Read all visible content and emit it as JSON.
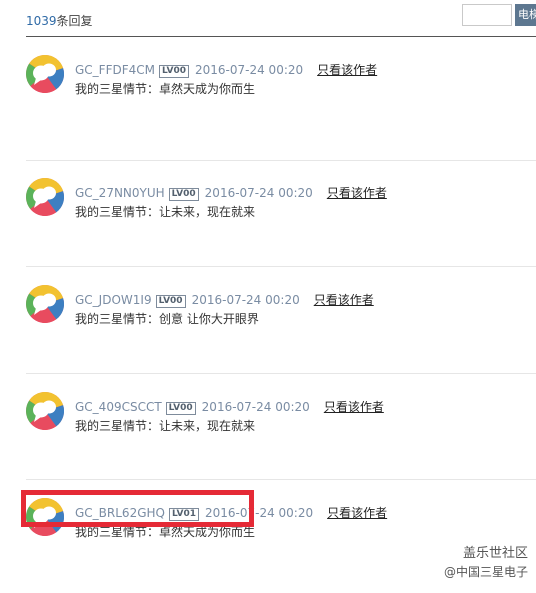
{
  "header": {
    "reply_count": "1039",
    "reply_suffix": "条回复",
    "search_value": "",
    "search_button_label": "电梯直达"
  },
  "posts": [
    {
      "username": "GC_FFDF4CM",
      "level": "LV00",
      "time": "2016-07-24 00:20",
      "author_link": "只看该作者",
      "content": "我的三星情节：卓然天成为你而生"
    },
    {
      "username": "GC_27NN0YUH",
      "level": "LV00",
      "time": "2016-07-24 00:20",
      "author_link": "只看该作者",
      "content": "我的三星情节：让未来，现在就来"
    },
    {
      "username": "GC_JDOW1I9",
      "level": "LV00",
      "time": "2016-07-24 00:20",
      "author_link": "只看该作者",
      "content": "我的三星情节：创意 让你大开眼界"
    },
    {
      "username": "GC_409CSCCT",
      "level": "LV00",
      "time": "2016-07-24 00:20",
      "author_link": "只看该作者",
      "content": "我的三星情节：让未来，现在就来"
    },
    {
      "username": "GC_BRL62GHQ",
      "level": "LV01",
      "time": "2016-07-24 00:20",
      "author_link": "只看该作者",
      "content": "我的三星情节：卓然天成为你而生"
    }
  ],
  "watermark": {
    "line1": "盖乐世社区",
    "line2": "@中国三星电子"
  },
  "colors": {
    "accent": "#2f6aa6",
    "highlight_border": "#e52a36",
    "avatar_red": "#e84b5f",
    "avatar_yellow": "#f2c230",
    "avatar_green": "#5bb35a",
    "avatar_blue": "#3d7fc1"
  }
}
